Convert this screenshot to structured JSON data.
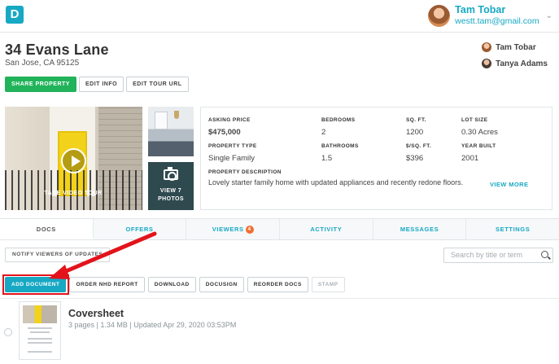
{
  "app": {
    "logo_letter": "D"
  },
  "user": {
    "name": "Tam Tobar",
    "email": "westt.tam@gmail.com"
  },
  "property": {
    "address": "34 Evans Lane",
    "city_state_zip": "San Jose, CA 95125"
  },
  "agents": [
    {
      "name": "Tam Tobar"
    },
    {
      "name": "Tanya Adams"
    }
  ],
  "header_buttons": {
    "share": "SHARE PROPERTY",
    "edit_info": "EDIT INFO",
    "edit_tour": "EDIT TOUR URL"
  },
  "media": {
    "video_caption": "TAKE VIDEO TOUR",
    "photos_line1": "VIEW 7",
    "photos_line2": "PHOTOS"
  },
  "details": {
    "asking_price_label": "ASKING PRICE",
    "asking_price": "$475,000",
    "bedrooms_label": "BEDROOMS",
    "bedrooms": "2",
    "sqft_label": "SQ. FT.",
    "sqft": "1200",
    "lot_label": "LOT SIZE",
    "lot": "0.30 Acres",
    "type_label": "PROPERTY TYPE",
    "type": "Single Family",
    "bathrooms_label": "BATHROOMS",
    "bathrooms": "1.5",
    "price_sqft_label": "$/SQ. FT.",
    "price_sqft": "$396",
    "year_label": "YEAR BUILT",
    "year": "2001",
    "desc_label": "PROPERTY DESCRIPTION",
    "desc": "Lovely starter family home with updated appliances and recently redone floors.",
    "view_more": "VIEW MORE"
  },
  "tabs": [
    {
      "label": "DOCS"
    },
    {
      "label": "OFFERS"
    },
    {
      "label": "VIEWERS",
      "badge": "4"
    },
    {
      "label": "ACTIVITY"
    },
    {
      "label": "MESSAGES"
    },
    {
      "label": "SETTINGS"
    }
  ],
  "toolbar": {
    "notify": "NOTIFY VIEWERS OF UPDATES",
    "search_placeholder": "Search by title or term"
  },
  "doc_actions": {
    "add": "ADD DOCUMENT",
    "order_nhd": "ORDER NHD REPORT",
    "download": "DOWNLOAD",
    "docusign": "DOCUSIGN",
    "reorder": "REORDER DOCS",
    "stamp": "STAMP"
  },
  "documents": [
    {
      "title": "Coversheet",
      "meta": "3 pages | 1.34 MB | Updated Apr 29, 2020 03:53PM"
    }
  ],
  "colors": {
    "accent": "#17a8c3",
    "green": "#21b35a",
    "highlight": "#e3131b",
    "badge": "#f06f30"
  }
}
